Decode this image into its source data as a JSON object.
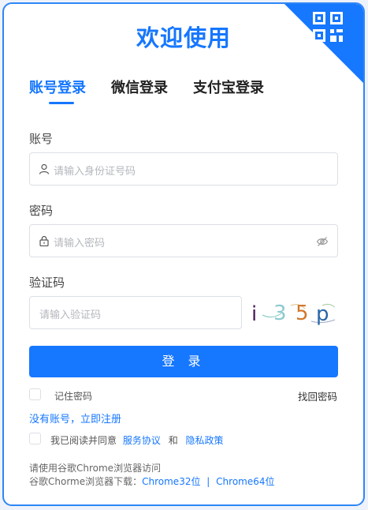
{
  "title": "欢迎使用",
  "tabs": [
    {
      "label": "账号登录",
      "active": true
    },
    {
      "label": "微信登录",
      "active": false
    },
    {
      "label": "支付宝登录",
      "active": false
    }
  ],
  "account": {
    "label": "账号",
    "placeholder": "请输入身份证号码"
  },
  "password": {
    "label": "密码",
    "placeholder": "请输入密码"
  },
  "captcha": {
    "label": "验证码",
    "placeholder": "请输入验证码",
    "code": [
      "i",
      "3",
      "5",
      "p"
    ]
  },
  "login_button": "登 录",
  "remember": "记住密码",
  "forgot": "找回密码",
  "register": "没有账号，立即注册",
  "agreement": {
    "prefix": "我已阅读并同意",
    "service": "服务协议",
    "and": "和",
    "privacy": "隐私政策"
  },
  "footer": {
    "line1": "请使用谷歌Chrome浏览器访问",
    "line2_prefix": "谷歌Chorme浏览器下载：",
    "chrome32": "Chrome32位",
    "separator": "|",
    "chrome64": "Chrome64位"
  },
  "colors": {
    "accent": "#1677ff",
    "border": "#2f86f6"
  }
}
